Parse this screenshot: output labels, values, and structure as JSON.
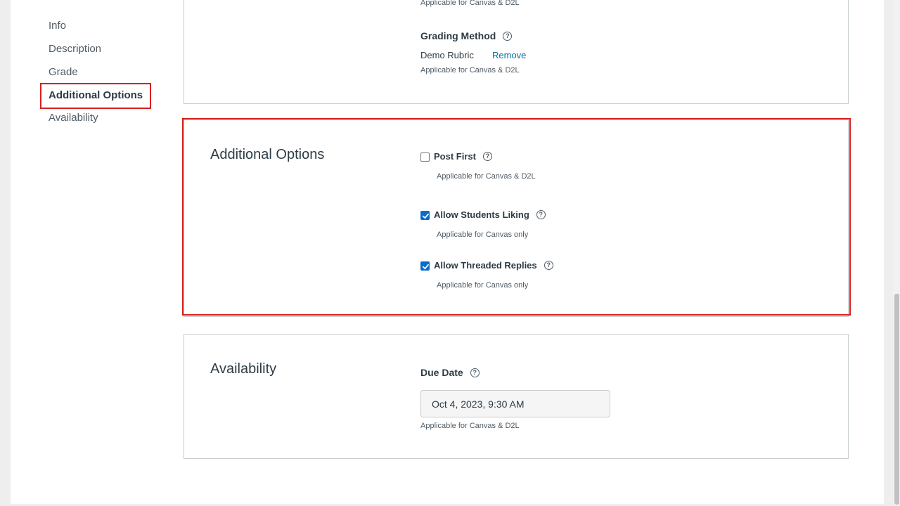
{
  "nav": {
    "items": [
      {
        "label": "Info"
      },
      {
        "label": "Description"
      },
      {
        "label": "Grade"
      },
      {
        "label": "Additional Options"
      },
      {
        "label": "Availability"
      }
    ]
  },
  "grade_section": {
    "top_note": "Applicable for Canvas & D2L",
    "grading_method_label": "Grading Method",
    "grading_method_value": "Demo Rubric",
    "remove_link": "Remove",
    "grading_method_note": "Applicable for Canvas & D2L"
  },
  "additional_options": {
    "title": "Additional Options",
    "options": [
      {
        "label": "Post First",
        "checked": false,
        "note": "Applicable for Canvas & D2L"
      },
      {
        "label": "Allow Students Liking",
        "checked": true,
        "note": "Applicable for Canvas only"
      },
      {
        "label": "Allow Threaded Replies",
        "checked": true,
        "note": "Applicable for Canvas only"
      }
    ]
  },
  "availability": {
    "title": "Availability",
    "due_date_label": "Due Date",
    "due_date_value": "Oct 4, 2023, 9:30 AM",
    "due_date_note": "Applicable for Canvas & D2L"
  },
  "icons": {
    "help": "question-circle-icon",
    "check": "checkmark-icon"
  },
  "colors": {
    "highlight": "#d9201d",
    "link": "#0770a3",
    "checkbox": "#0b6bcb"
  }
}
